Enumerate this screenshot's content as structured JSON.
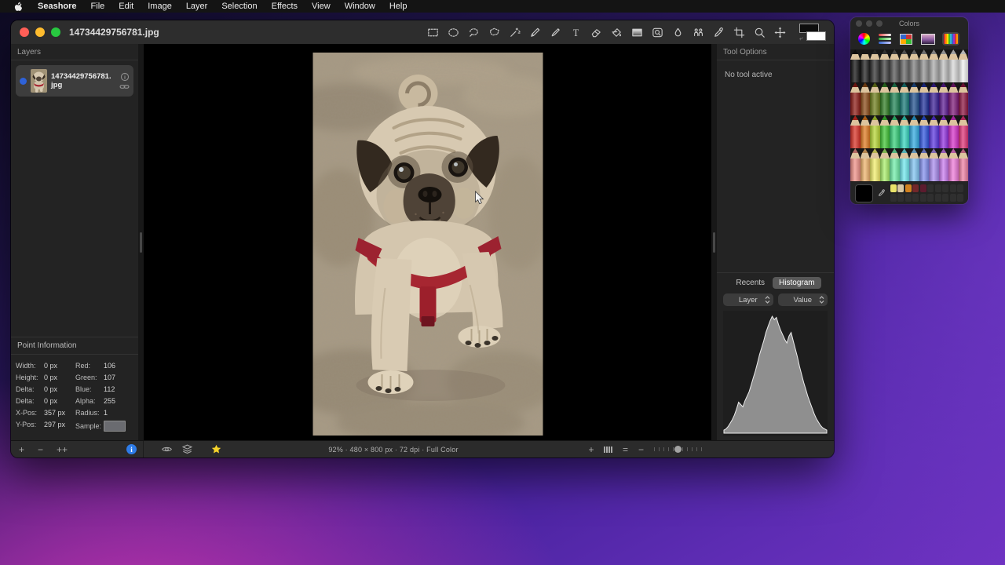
{
  "menu_bar": {
    "apple_icon": "apple-logo",
    "items": [
      "Seashore",
      "File",
      "Edit",
      "Image",
      "Layer",
      "Selection",
      "Effects",
      "View",
      "Window",
      "Help"
    ]
  },
  "window": {
    "title": "14734429756781.jpg",
    "toolbar_tools": [
      "rect-select",
      "ellipse-select",
      "lasso",
      "polygon-lasso",
      "wand",
      "pencil",
      "brush",
      "text",
      "eraser",
      "bucket",
      "gradient",
      "stamp",
      "smudge",
      "clone",
      "eyedropper",
      "crop",
      "zoom",
      "position"
    ],
    "color_wells": {
      "foreground": "#0d0d0d",
      "background": "#ffffff"
    },
    "layers_panel": {
      "header": "Layers",
      "layer_name": "14734429756781.jpg"
    },
    "point_info": {
      "header": "Point Information",
      "left_rows": [
        {
          "label": "Width:",
          "value": "0 px"
        },
        {
          "label": "Height:",
          "value": "0 px"
        },
        {
          "label": "Delta:",
          "value": "0 px"
        },
        {
          "label": "Delta:",
          "value": "0 px"
        },
        {
          "label": "X-Pos:",
          "value": "357 px"
        },
        {
          "label": "Y-Pos:",
          "value": "297 px"
        }
      ],
      "right_rows": [
        {
          "label": "Red:",
          "value": "106"
        },
        {
          "label": "Green:",
          "value": "107"
        },
        {
          "label": "Blue:",
          "value": "112"
        },
        {
          "label": "Alpha:",
          "value": "255"
        },
        {
          "label": "Radius:",
          "value": "1"
        }
      ],
      "sample_label": "Sample:",
      "sample_color": "#6a6b70"
    },
    "tool_options": {
      "header": "Tool Options",
      "status": "No tool active"
    },
    "inspector": {
      "tabs": [
        "Recents",
        "Histogram"
      ],
      "active_tab": "Histogram",
      "channel_dropdown": "Layer",
      "value_dropdown": "Value"
    },
    "status_bar": "92% · 480 × 800 px · 72 dpi · Full Color",
    "footer": {
      "left_buttons": [
        "+",
        "−",
        "++"
      ],
      "info_glyph": "i",
      "right_plus": "+",
      "right_equals": "=",
      "right_minus": "−"
    }
  },
  "chart_data": {
    "type": "area",
    "title": "Histogram",
    "xlabel": "Value",
    "x_range": [
      0,
      255
    ],
    "ylim": [
      0,
      1
    ],
    "grid": false,
    "legend": false,
    "fill_color": "#8f8f8f",
    "line_color": "#ededed",
    "series": [
      {
        "name": "Value",
        "values": [
          0.02,
          0.03,
          0.05,
          0.08,
          0.11,
          0.15,
          0.2,
          0.26,
          0.24,
          0.22,
          0.27,
          0.31,
          0.35,
          0.41,
          0.47,
          0.53,
          0.6,
          0.67,
          0.73,
          0.79,
          0.86,
          0.91,
          0.96,
          1.0,
          0.97,
          0.99,
          0.93,
          0.88,
          0.84,
          0.8,
          0.77,
          0.83,
          0.86,
          0.79,
          0.72,
          0.65,
          0.57,
          0.5,
          0.43,
          0.37,
          0.31,
          0.26,
          0.21,
          0.16,
          0.12,
          0.09,
          0.06,
          0.04,
          0.03,
          0.02
        ]
      }
    ]
  },
  "colors_panel": {
    "title": "Colors",
    "toolbar": [
      "color-wheel",
      "color-sliders",
      "color-palette",
      "color-image",
      "color-pencils"
    ],
    "active_tool": "color-pencils",
    "current_color": "#000000",
    "recent_swatches": [
      "#e9e36a",
      "#d8c8a4",
      "#d2821f",
      "#73272a",
      "#5c1b2e"
    ],
    "swatch_slot_count": 20,
    "pencil_rows": [
      [
        "#101010",
        "#1f1f1f",
        "#303030",
        "#424242",
        "#555555",
        "#696969",
        "#7e7e7e",
        "#949494",
        "#aaaaaa",
        "#c1c1c1",
        "#d9d9d9",
        "#f1f1f1"
      ],
      [
        "#8c1a14",
        "#8a4a16",
        "#6d7d1a",
        "#2f7d22",
        "#1f8455",
        "#177a78",
        "#1f4f8d",
        "#20309a",
        "#3a1e96",
        "#5c1a92",
        "#7d1877",
        "#8c1440"
      ],
      [
        "#d92f23",
        "#e07a1f",
        "#b5d632",
        "#3fc433",
        "#35d07a",
        "#35d6c0",
        "#2fa9e0",
        "#2f55e0",
        "#5a35e0",
        "#9230e0",
        "#d630c9",
        "#e03277"
      ],
      [
        "#ef8f86",
        "#efb36b",
        "#f3ef6a",
        "#a9ef6a",
        "#6fefa9",
        "#6fe9ef",
        "#7fc3f2",
        "#8390ef",
        "#a98bef",
        "#c979ef",
        "#ef79d9",
        "#ef7fa4"
      ]
    ]
  }
}
